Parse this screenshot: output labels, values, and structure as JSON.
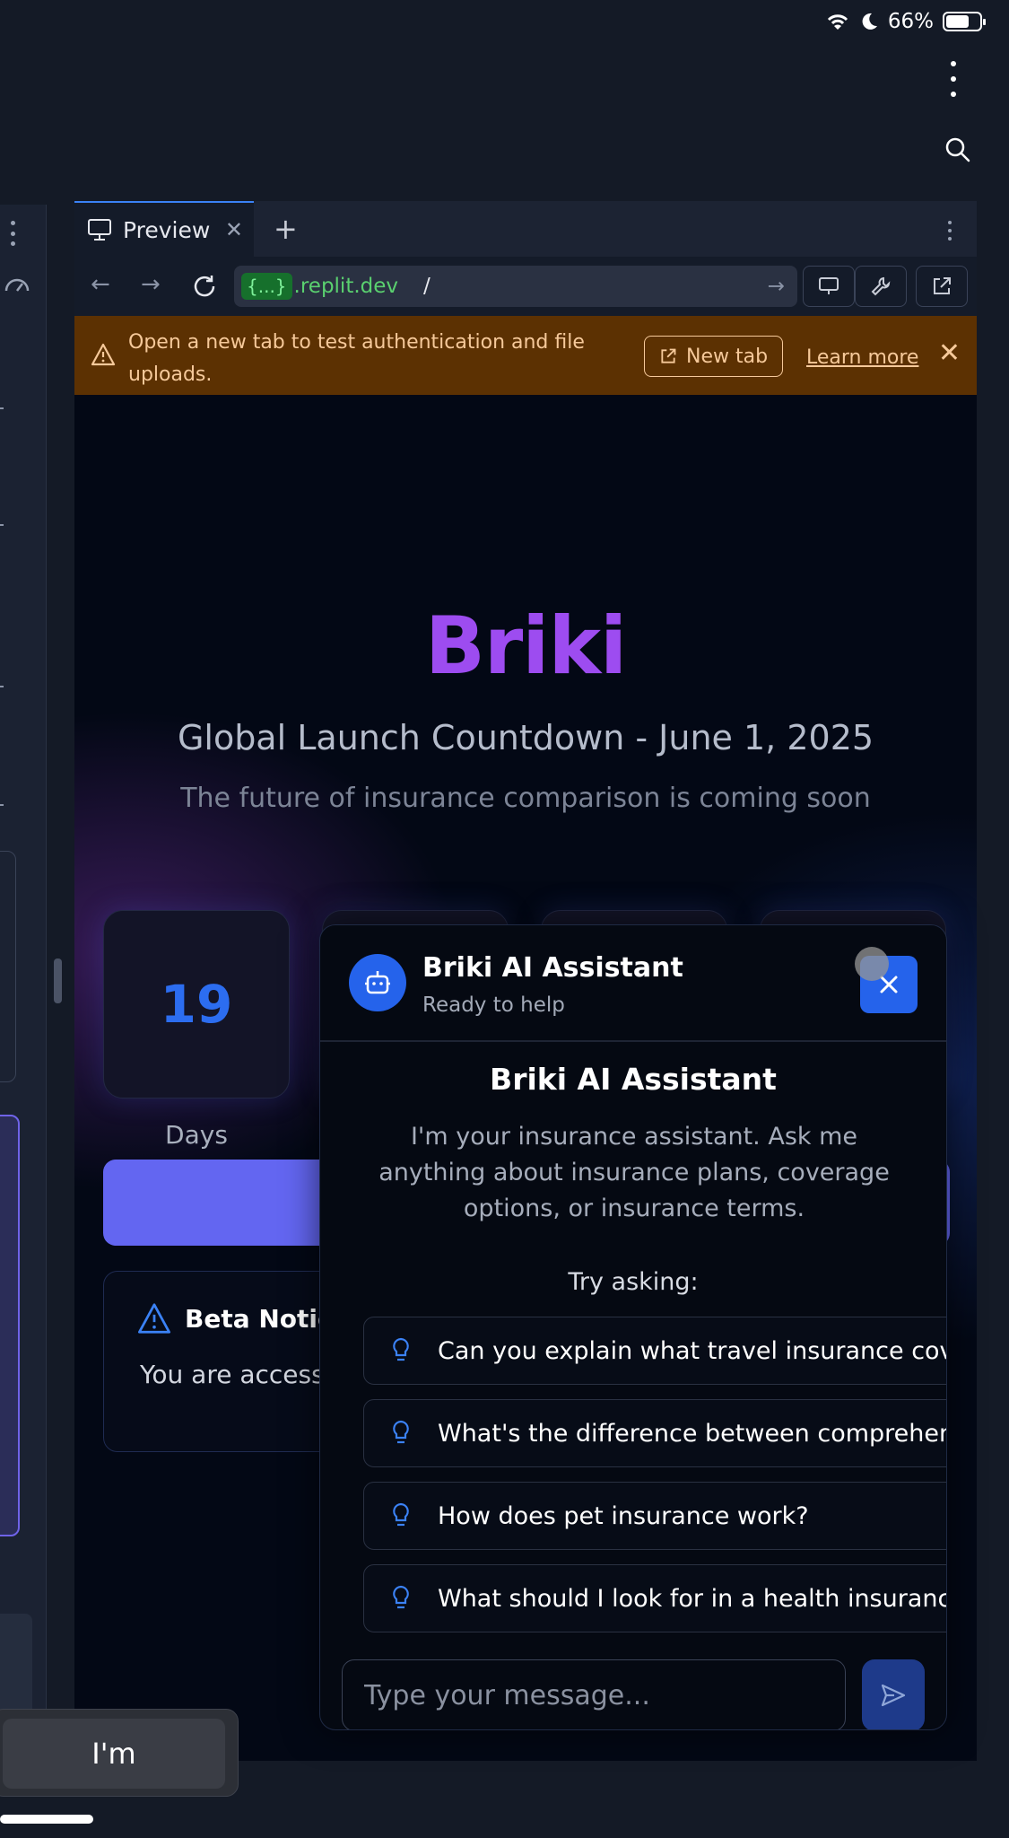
{
  "status_bar": {
    "battery": "66%"
  },
  "browser": {
    "tab": {
      "label": "Preview"
    },
    "url": {
      "badge": "{...}",
      "host": ".replit.dev",
      "path": "/"
    }
  },
  "banner": {
    "message": "Open a new tab to test authentication and file uploads.",
    "new_tab": "New tab",
    "learn_more": "Learn more"
  },
  "page": {
    "brand": "Briki",
    "headline": "Global Launch Countdown - June 1, 2025",
    "subtitle": "The future of insurance comparison is coming soon",
    "countdown": {
      "days_value": "19",
      "days_label": "Days"
    },
    "beta": {
      "title": "Beta Notice",
      "text": "You are access"
    }
  },
  "chat": {
    "title": "Briki AI Assistant",
    "status": "Ready to help",
    "welcome_title": "Briki AI Assistant",
    "welcome_text": "I'm your insurance assistant. Ask me anything about insurance plans, coverage options, or insurance terms.",
    "try_label": "Try asking:",
    "suggestions": [
      "Can you explain what travel insurance cov",
      "What's the difference between comprehen",
      "How does pet insurance work?",
      "What should I look for in a health insuranc"
    ],
    "input_placeholder": "Type your message..."
  },
  "keyboard_suggestion": "I'm",
  "colors": {
    "brand": "#9d4cf0",
    "accent": "#2563eb",
    "banner": "#5c3102",
    "cta": "#6366f1"
  }
}
